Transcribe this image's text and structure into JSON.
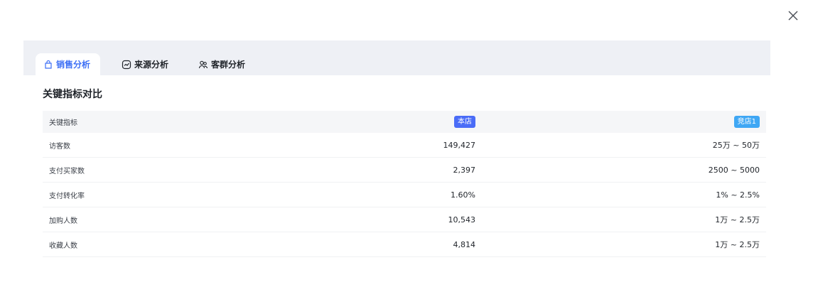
{
  "tabs": [
    {
      "label": "销售分析",
      "icon": "shopping-bag-icon",
      "active": true
    },
    {
      "label": "来源分析",
      "icon": "chart-trend-icon",
      "active": false
    },
    {
      "label": "客群分析",
      "icon": "users-icon",
      "active": false
    }
  ],
  "section_title": "关键指标对比",
  "table": {
    "headers": [
      "关键指标",
      "本店",
      "竞店1"
    ],
    "rows": [
      [
        "访客数",
        "149,427",
        "25万 ~ 50万"
      ],
      [
        "支付买家数",
        "2,397",
        "2500 ~ 5000"
      ],
      [
        "支付转化率",
        "1.60%",
        "1% ~ 2.5%"
      ],
      [
        "加购人数",
        "10,543",
        "1万 ~ 2.5万"
      ],
      [
        "收藏人数",
        "4,814",
        "1万 ~ 2.5万"
      ]
    ]
  },
  "colors": {
    "accent": "#3d6ff5",
    "own_badge": "#4a6cf7",
    "competitor_badge": "#3fa7f4",
    "tabbar_bg": "#eef0f5"
  }
}
